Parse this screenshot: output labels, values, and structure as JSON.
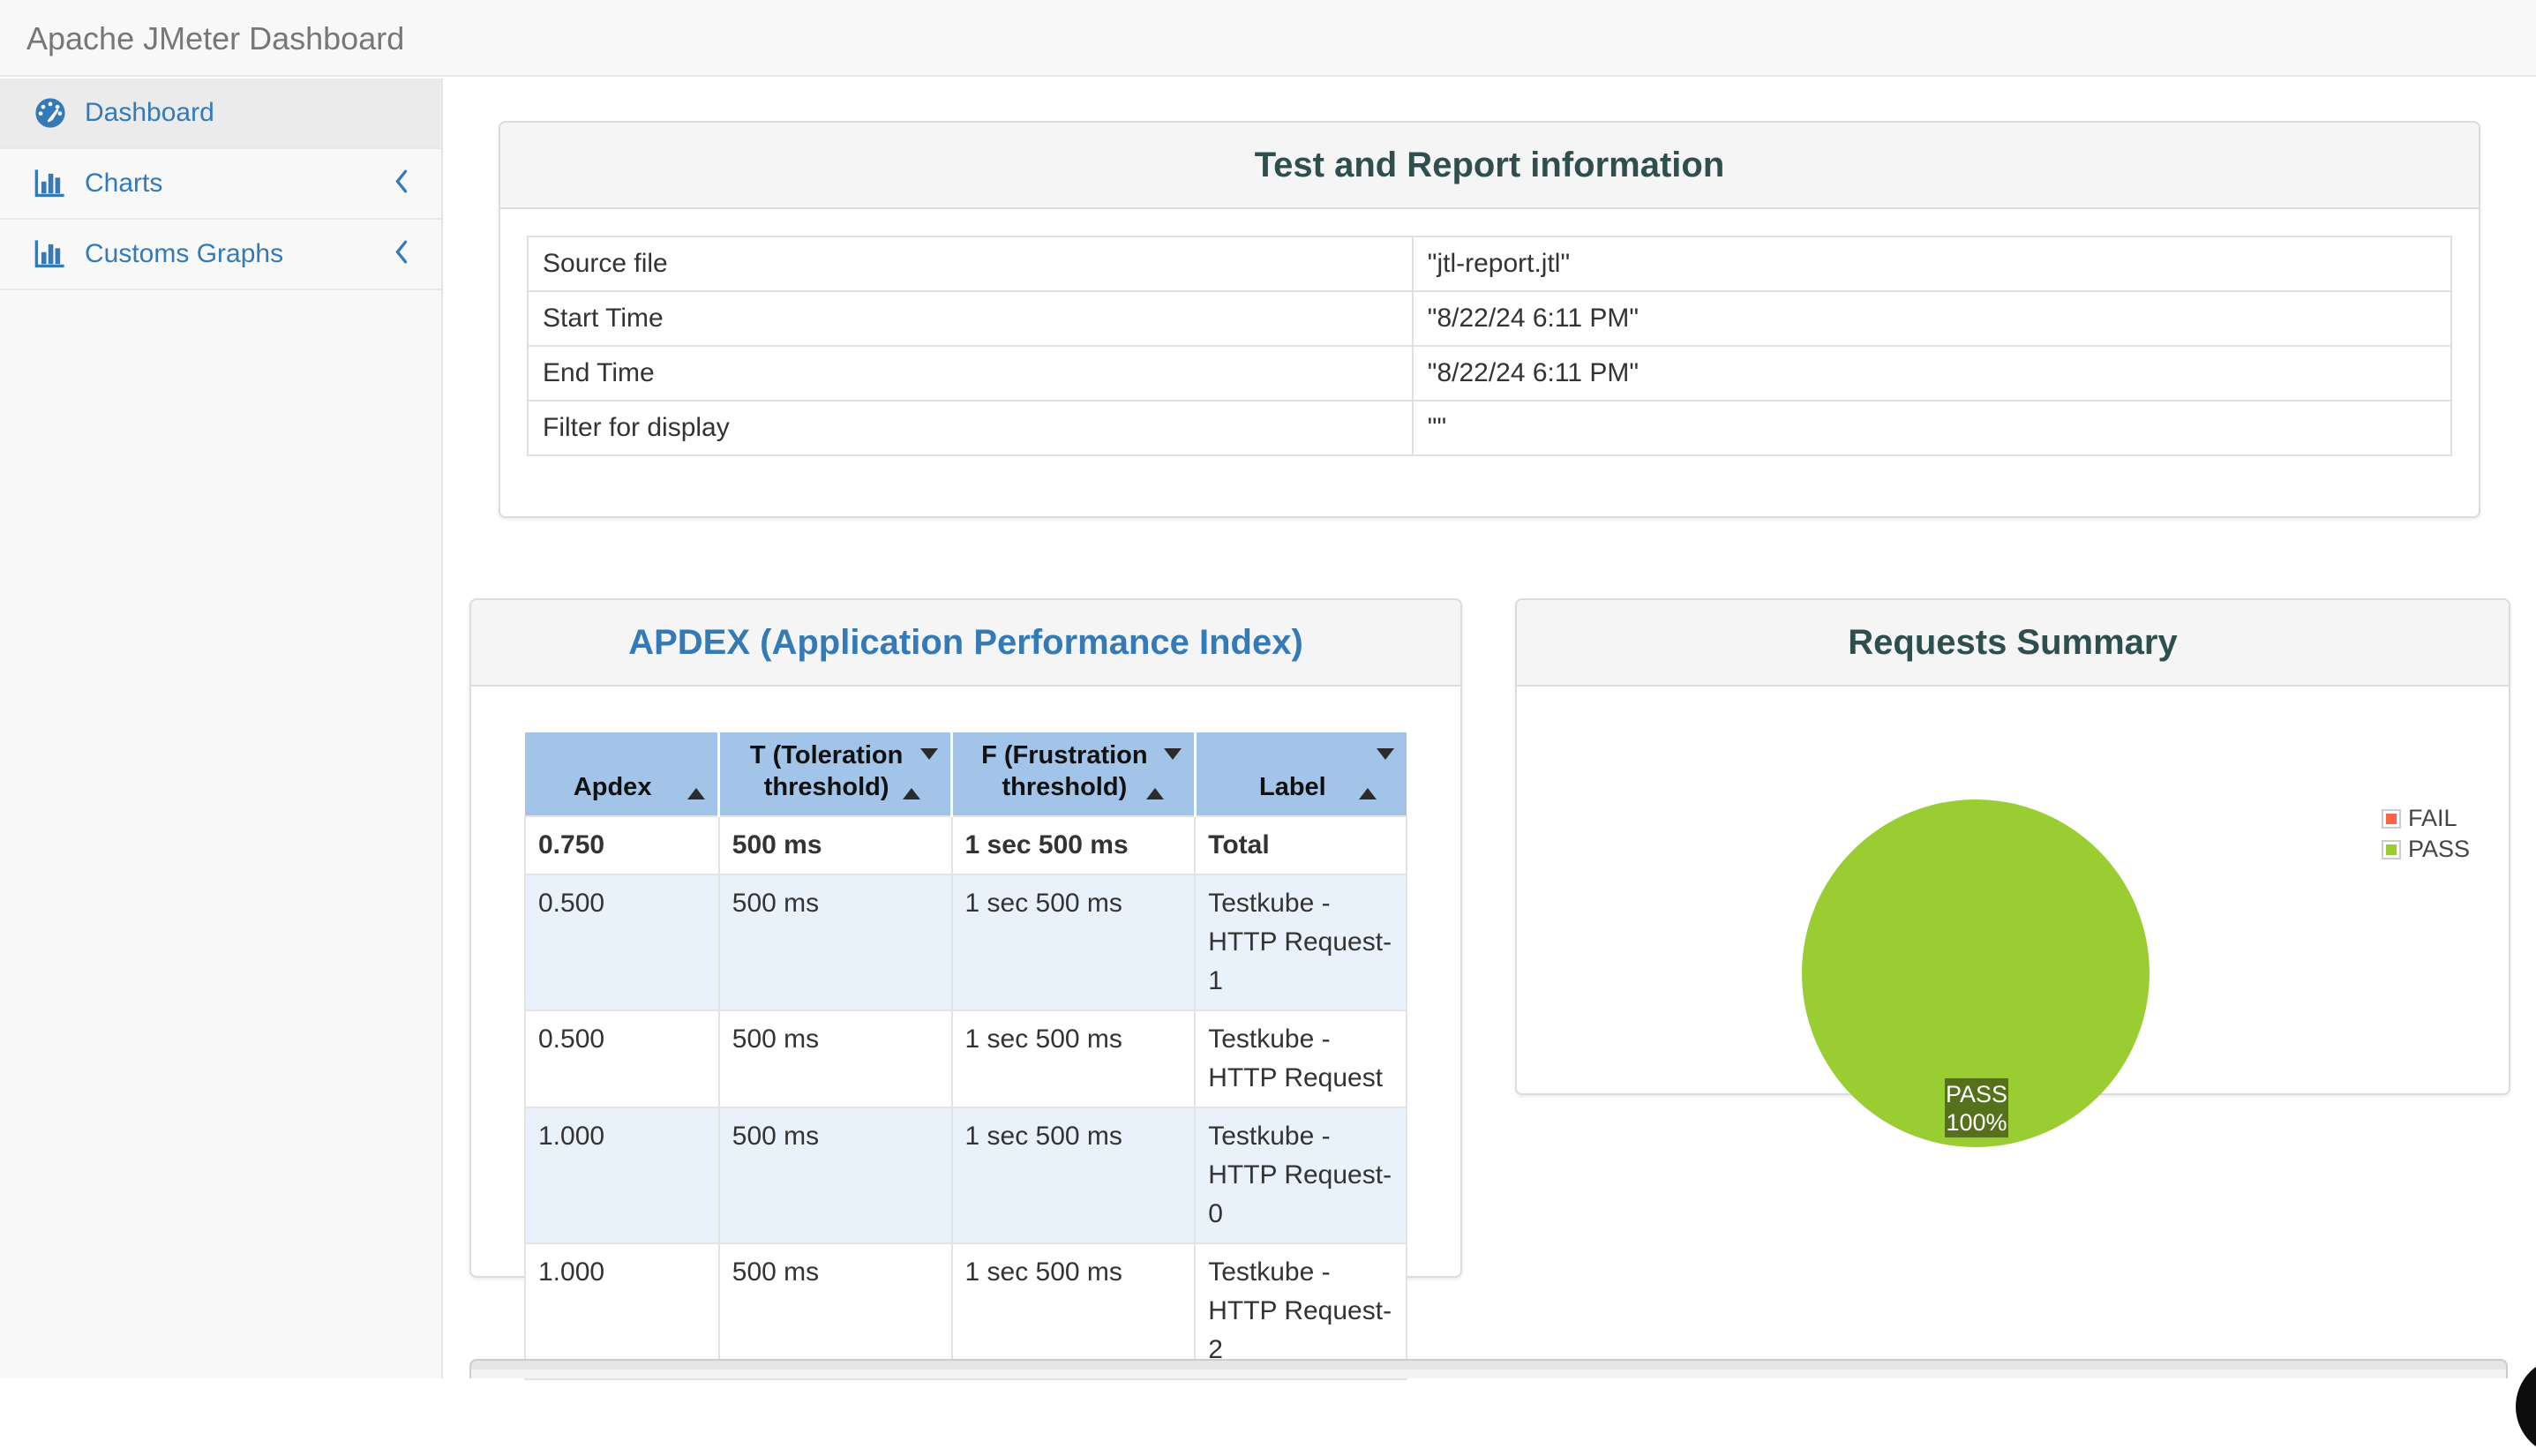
{
  "app": {
    "title": "Apache JMeter Dashboard"
  },
  "sidebar": {
    "items": [
      {
        "label": "Dashboard",
        "icon": "gauge-icon",
        "active": true
      },
      {
        "label": "Charts",
        "icon": "bar-chart-icon",
        "active": false,
        "collapsed": true
      },
      {
        "label": "Customs Graphs",
        "icon": "bar-chart-icon",
        "active": false,
        "collapsed": true
      }
    ]
  },
  "panels": {
    "test_info": {
      "title": "Test and Report information",
      "rows": [
        {
          "label": "Source file",
          "value": "\"jtl-report.jtl\""
        },
        {
          "label": "Start Time",
          "value": "\"8/22/24 6:11 PM\""
        },
        {
          "label": "End Time",
          "value": "\"8/22/24 6:11 PM\""
        },
        {
          "label": "Filter for display",
          "value": "\"\""
        }
      ]
    },
    "apdex": {
      "title": "APDEX (Application Performance Index)",
      "columns": [
        "Apdex",
        "T (Toleration threshold)",
        "F (Frustration threshold)",
        "Label"
      ],
      "sort": {
        "column": "Apdex",
        "direction": "ascending"
      },
      "rows": [
        [
          "0.750",
          "500 ms",
          "1 sec 500 ms",
          "Total"
        ],
        [
          "0.500",
          "500 ms",
          "1 sec 500 ms",
          "Testkube - HTTP Request-1"
        ],
        [
          "0.500",
          "500 ms",
          "1 sec 500 ms",
          "Testkube - HTTP Request"
        ],
        [
          "1.000",
          "500 ms",
          "1 sec 500 ms",
          "Testkube - HTTP Request-0"
        ],
        [
          "1.000",
          "500 ms",
          "1 sec 500 ms",
          "Testkube - HTTP Request-2"
        ]
      ]
    },
    "requests_summary": {
      "title": "Requests Summary"
    }
  },
  "chart_data": {
    "type": "pie",
    "title": "Requests Summary",
    "slices": [
      {
        "label": "FAIL",
        "value": 0,
        "color": "#FF6347"
      },
      {
        "label": "PASS",
        "value": 100,
        "color": "#9ACD32"
      }
    ],
    "legend": {
      "position": "top-right",
      "entries": [
        "FAIL",
        "PASS"
      ]
    },
    "center_label": {
      "line1": "PASS",
      "line2": "100%",
      "bg": "#55711B"
    }
  },
  "colors": {
    "accent_blue": "#337ab7",
    "panel_title": "#2f4f4f",
    "table_header_bg": "#a1c4e8",
    "stripe_row_bg": "#e9f1fb",
    "pass_green": "#9ACD32",
    "fail_red": "#FF6347"
  }
}
